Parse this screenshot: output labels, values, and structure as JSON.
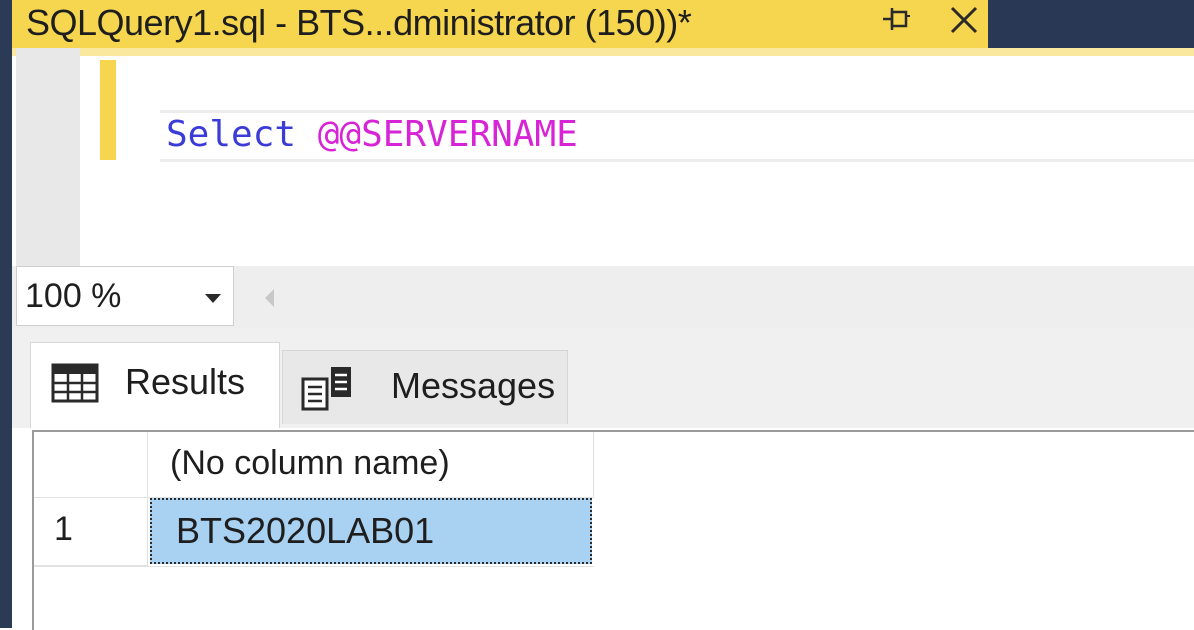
{
  "window": {
    "tab_title": "SQLQuery1.sql - BTS...dministrator (150))*"
  },
  "editor": {
    "keyword": "Select",
    "space": " ",
    "function": "@@SERVERNAME"
  },
  "zoom": {
    "value": "100 %"
  },
  "tabs": [
    {
      "label": "Results",
      "icon": "grid-icon"
    },
    {
      "label": "Messages",
      "icon": "messages-icon"
    }
  ],
  "results": {
    "columns": [
      "(No column name)"
    ],
    "rows": [
      {
        "num": "1",
        "cells": [
          "BTS2020LAB01"
        ]
      }
    ]
  },
  "colors": {
    "tab_active": "#f6d64e",
    "frame": "#293955",
    "keyword": "#3b3bd8",
    "system_function": "#d624d6",
    "selected_cell": "#a9d1f1"
  }
}
